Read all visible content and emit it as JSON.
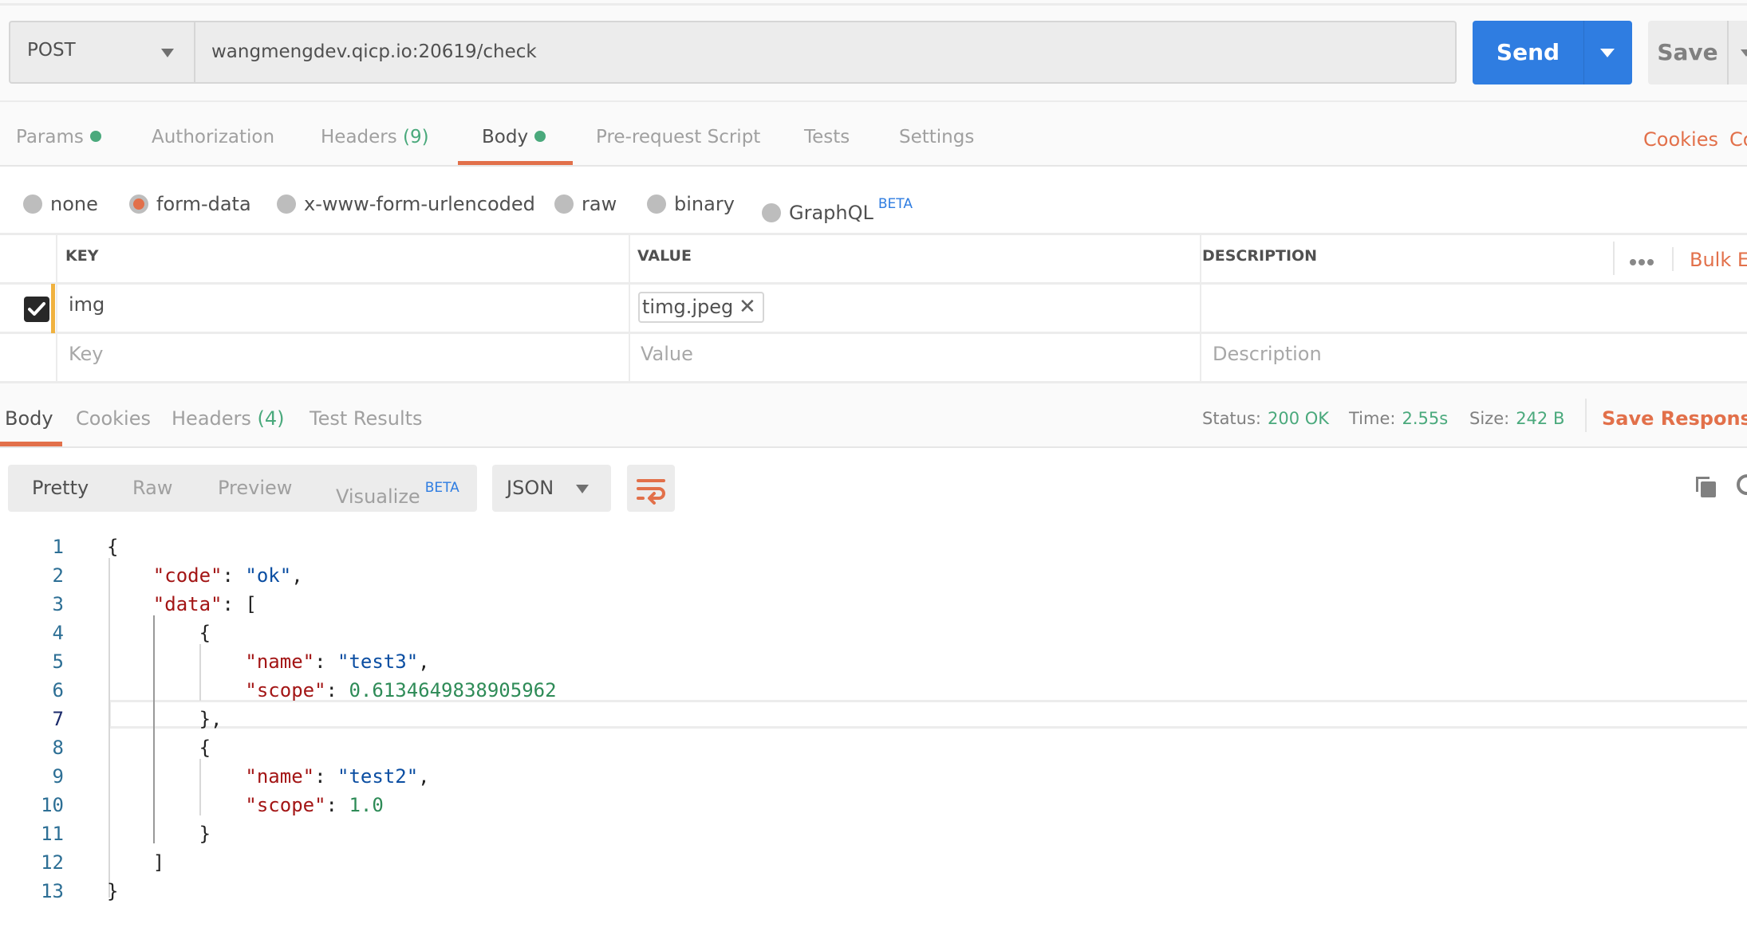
{
  "request": {
    "method": "POST",
    "url": "wangmengdev.qicp.io:20619/check",
    "send_label": "Send",
    "save_label": "Save"
  },
  "request_tabs": [
    {
      "label": "Params",
      "dot": true,
      "active": false
    },
    {
      "label": "Authorization",
      "active": false
    },
    {
      "label": "Headers",
      "count": "(9)",
      "active": false
    },
    {
      "label": "Body",
      "dot": true,
      "active": true
    },
    {
      "label": "Pre-request Script",
      "active": false
    },
    {
      "label": "Tests",
      "active": false
    },
    {
      "label": "Settings",
      "active": false
    }
  ],
  "request_links": {
    "cookies": "Cookies",
    "code": "Code"
  },
  "body_types": [
    {
      "label": "none",
      "selected": false
    },
    {
      "label": "form-data",
      "selected": true
    },
    {
      "label": "x-www-form-urlencoded",
      "selected": false
    },
    {
      "label": "raw",
      "selected": false
    },
    {
      "label": "binary",
      "selected": false
    },
    {
      "label": "GraphQL",
      "badge": "BETA",
      "selected": false
    }
  ],
  "form_table": {
    "headers": {
      "key": "KEY",
      "value": "VALUE",
      "description": "DESCRIPTION"
    },
    "bulk_edit": "Bulk Edit",
    "rows": [
      {
        "checked": true,
        "key": "img",
        "value_file": "timg.jpeg",
        "description": ""
      }
    ],
    "placeholders": {
      "key": "Key",
      "value": "Value",
      "description": "Description"
    }
  },
  "response_tabs": [
    {
      "label": "Body",
      "active": true
    },
    {
      "label": "Cookies",
      "active": false
    },
    {
      "label": "Headers",
      "count": "(4)",
      "active": false
    },
    {
      "label": "Test Results",
      "active": false
    }
  ],
  "response_status": {
    "status_label": "Status:",
    "status": "200 OK",
    "time_label": "Time:",
    "time": "2.55s",
    "size_label": "Size:",
    "size": "242 B",
    "save_response": "Save Response"
  },
  "response_view": {
    "modes": [
      "Pretty",
      "Raw",
      "Preview",
      "Visualize"
    ],
    "active_mode": "Pretty",
    "visualize_badge": "BETA",
    "format": "JSON"
  },
  "response_body": {
    "active_line": 7,
    "lines": [
      {
        "n": "1",
        "parts": [
          [
            "p",
            "{"
          ]
        ]
      },
      {
        "n": "2",
        "indent": "    ",
        "parts": [
          [
            "k",
            "\"code\""
          ],
          [
            "p",
            ": "
          ],
          [
            "s",
            "\"ok\""
          ],
          [
            "p",
            ","
          ]
        ]
      },
      {
        "n": "3",
        "indent": "    ",
        "parts": [
          [
            "k",
            "\"data\""
          ],
          [
            "p",
            ": ["
          ]
        ]
      },
      {
        "n": "4",
        "indent": "        ",
        "parts": [
          [
            "p",
            "{"
          ]
        ]
      },
      {
        "n": "5",
        "indent": "            ",
        "parts": [
          [
            "k",
            "\"name\""
          ],
          [
            "p",
            ": "
          ],
          [
            "s",
            "\"test3\""
          ],
          [
            "p",
            ","
          ]
        ]
      },
      {
        "n": "6",
        "indent": "            ",
        "parts": [
          [
            "k",
            "\"scope\""
          ],
          [
            "p",
            ": "
          ],
          [
            "n",
            "0.6134649838905962"
          ]
        ]
      },
      {
        "n": "7",
        "indent": "        ",
        "parts": [
          [
            "p",
            "},"
          ]
        ]
      },
      {
        "n": "8",
        "indent": "        ",
        "parts": [
          [
            "p",
            "{"
          ]
        ]
      },
      {
        "n": "9",
        "indent": "            ",
        "parts": [
          [
            "k",
            "\"name\""
          ],
          [
            "p",
            ": "
          ],
          [
            "s",
            "\"test2\""
          ],
          [
            "p",
            ","
          ]
        ]
      },
      {
        "n": "10",
        "indent": "            ",
        "parts": [
          [
            "k",
            "\"scope\""
          ],
          [
            "p",
            ": "
          ],
          [
            "n",
            "1.0"
          ]
        ]
      },
      {
        "n": "11",
        "indent": "        ",
        "parts": [
          [
            "p",
            "}"
          ]
        ]
      },
      {
        "n": "12",
        "indent": "    ",
        "parts": [
          [
            "p",
            "]"
          ]
        ]
      },
      {
        "n": "13",
        "parts": [
          [
            "p",
            "}"
          ]
        ]
      }
    ]
  },
  "colors": {
    "accent_orange": "#e2704a",
    "send_blue": "#2f7de1",
    "success_green": "#4aa97c",
    "row_marker": "#f0b23f"
  }
}
